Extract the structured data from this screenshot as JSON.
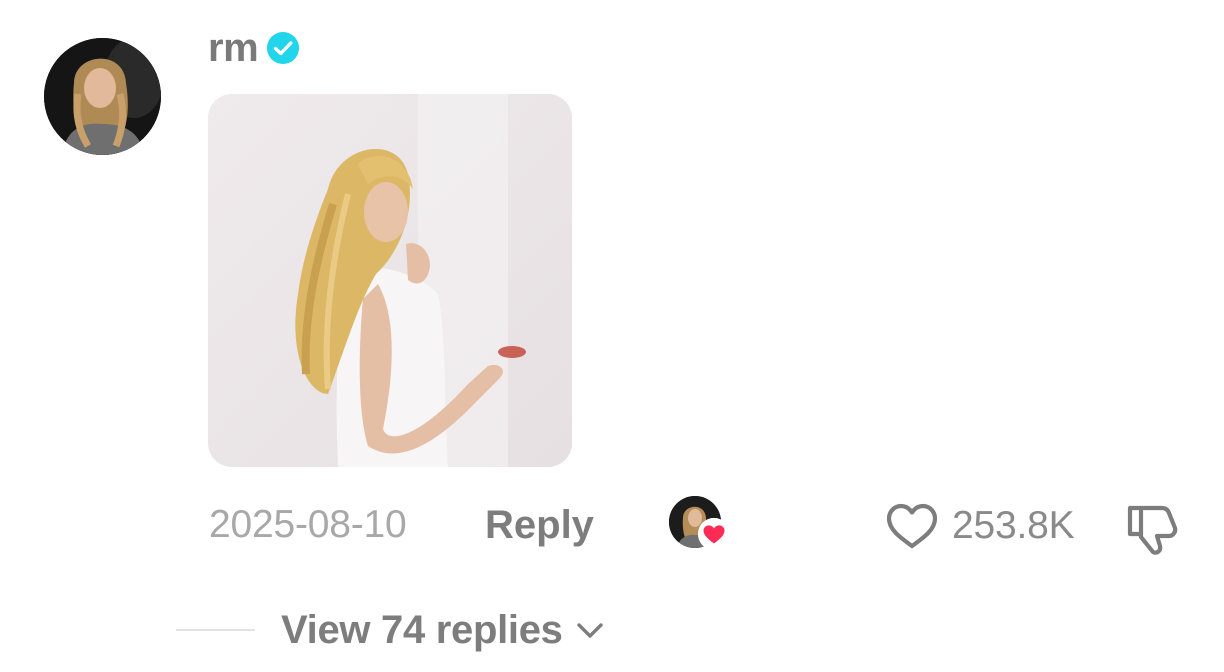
{
  "comment": {
    "username": "rm",
    "verified": true,
    "date": "2025-08-10",
    "reply_label": "Reply",
    "like_count": "253.8K",
    "liked_by_creator": true,
    "view_replies_label": "View 74 replies"
  },
  "icons": {
    "verified": "verified-badge-icon",
    "like": "heart-outline-icon",
    "dislike": "thumbs-down-icon",
    "creator_like": "heart-filled-icon",
    "expand": "chevron-down-icon"
  },
  "colors": {
    "verified_badge": "#20D5EC",
    "creator_heart": "#FE2C55",
    "username": "#7A7A7A",
    "muted_text": "#A8A8A8",
    "icon_gray": "#7D7D7D"
  }
}
